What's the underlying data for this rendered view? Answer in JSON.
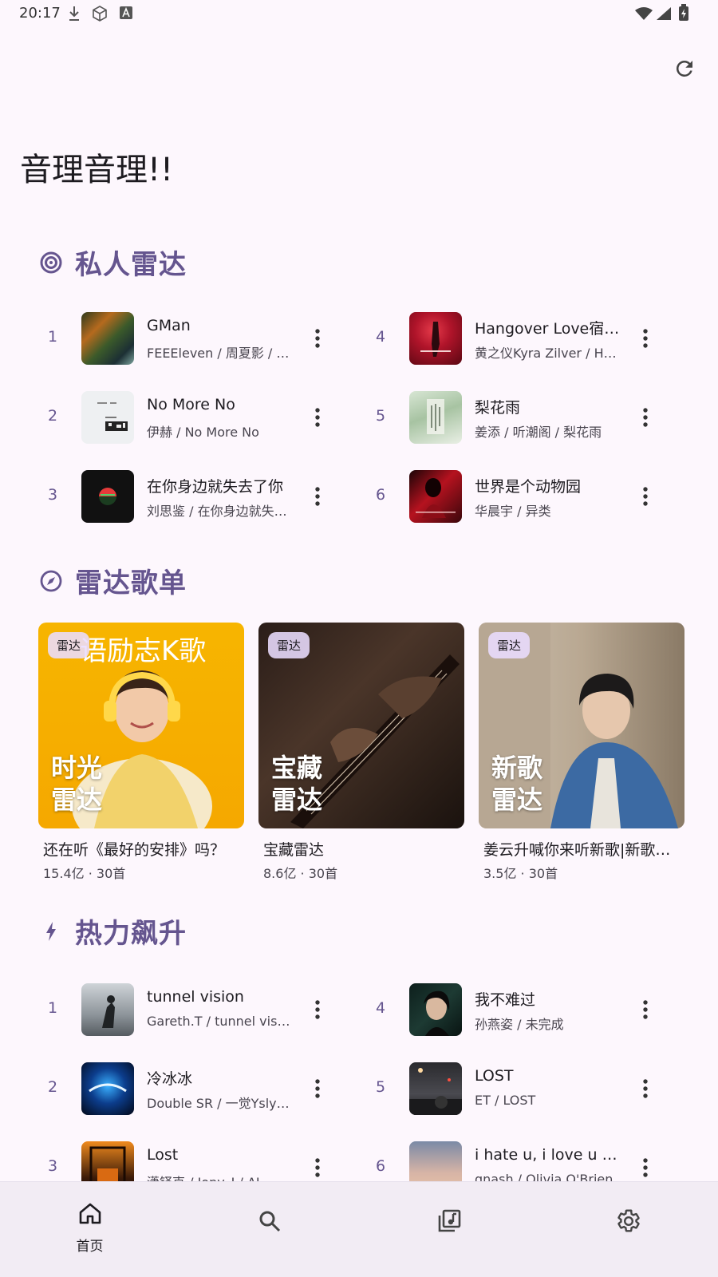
{
  "status": {
    "time": "20:17"
  },
  "app": {
    "title": "音理音理!!"
  },
  "radar": {
    "title": "私人雷达",
    "songs": [
      {
        "rank": "1",
        "title": "GMan",
        "subtitle": "FEEEleven / 周夏影 / GMan"
      },
      {
        "rank": "2",
        "title": "No More No",
        "subtitle": "伊赫 / No More No"
      },
      {
        "rank": "3",
        "title": "在你身边就失去了你",
        "subtitle": "刘思鉴 / 在你身边就失去了你"
      },
      {
        "rank": "4",
        "title": "Hangover Love宿醉之恋",
        "subtitle": "黄之仪Kyra Zilver / Hangover Love"
      },
      {
        "rank": "5",
        "title": "梨花雨",
        "subtitle": "姜添 / 听潮阁 / 梨花雨"
      },
      {
        "rank": "6",
        "title": "世界是个动物园",
        "subtitle": "华晨宇 / 异类"
      }
    ]
  },
  "playlists": {
    "title": "雷达歌单",
    "items": [
      {
        "badge": "雷达",
        "overlay1": "时光",
        "overlay2": "雷达",
        "toptext": "语励志K歌",
        "name": "还在听《最好的安排》吗？",
        "meta": "15.4亿 · 30首"
      },
      {
        "badge": "雷达",
        "overlay1": "宝藏",
        "overlay2": "雷达",
        "toptext": "",
        "name": "宝藏雷达",
        "meta": "8.6亿 · 30首"
      },
      {
        "badge": "雷达",
        "overlay1": "新歌",
        "overlay2": "雷达",
        "toptext": "",
        "name": "姜云升喊你来听新歌|新歌雷达",
        "meta": "3.5亿 · 30首"
      }
    ]
  },
  "trending": {
    "title": "热力飙升",
    "songs": [
      {
        "rank": "1",
        "title": "tunnel vision",
        "subtitle": "Gareth.T / tunnel vision"
      },
      {
        "rank": "2",
        "title": "冷冰冰",
        "subtitle": "Double SR / 一觉Yslyd / 冷冰冰"
      },
      {
        "rank": "3",
        "title": "Lost",
        "subtitle": "潇铎克 / Jony_J / AI"
      },
      {
        "rank": "4",
        "title": "我不难过",
        "subtitle": "孙燕姿 / 未完成"
      },
      {
        "rank": "5",
        "title": "LOST",
        "subtitle": "ET / LOST"
      },
      {
        "rank": "6",
        "title": "i hate u, i love u (feat. olivia o'brien)",
        "subtitle": "gnash / Olivia O'Brien"
      }
    ]
  },
  "nav": {
    "home": "首页",
    "search": "",
    "library": "",
    "settings": ""
  },
  "colors": {
    "accent": "#65558f",
    "background": "#fdf7fd",
    "nav_bg": "#f2ecf4",
    "badge_bg": "#eaddff"
  },
  "icons": [
    "download-icon",
    "cube-icon",
    "a-icon",
    "wifi-icon",
    "signal-icon",
    "battery-icon",
    "refresh-icon",
    "radar-icon",
    "compass-icon",
    "bolt-icon",
    "more-vert-icon",
    "home-icon",
    "search-icon",
    "library-music-icon",
    "settings-icon"
  ]
}
